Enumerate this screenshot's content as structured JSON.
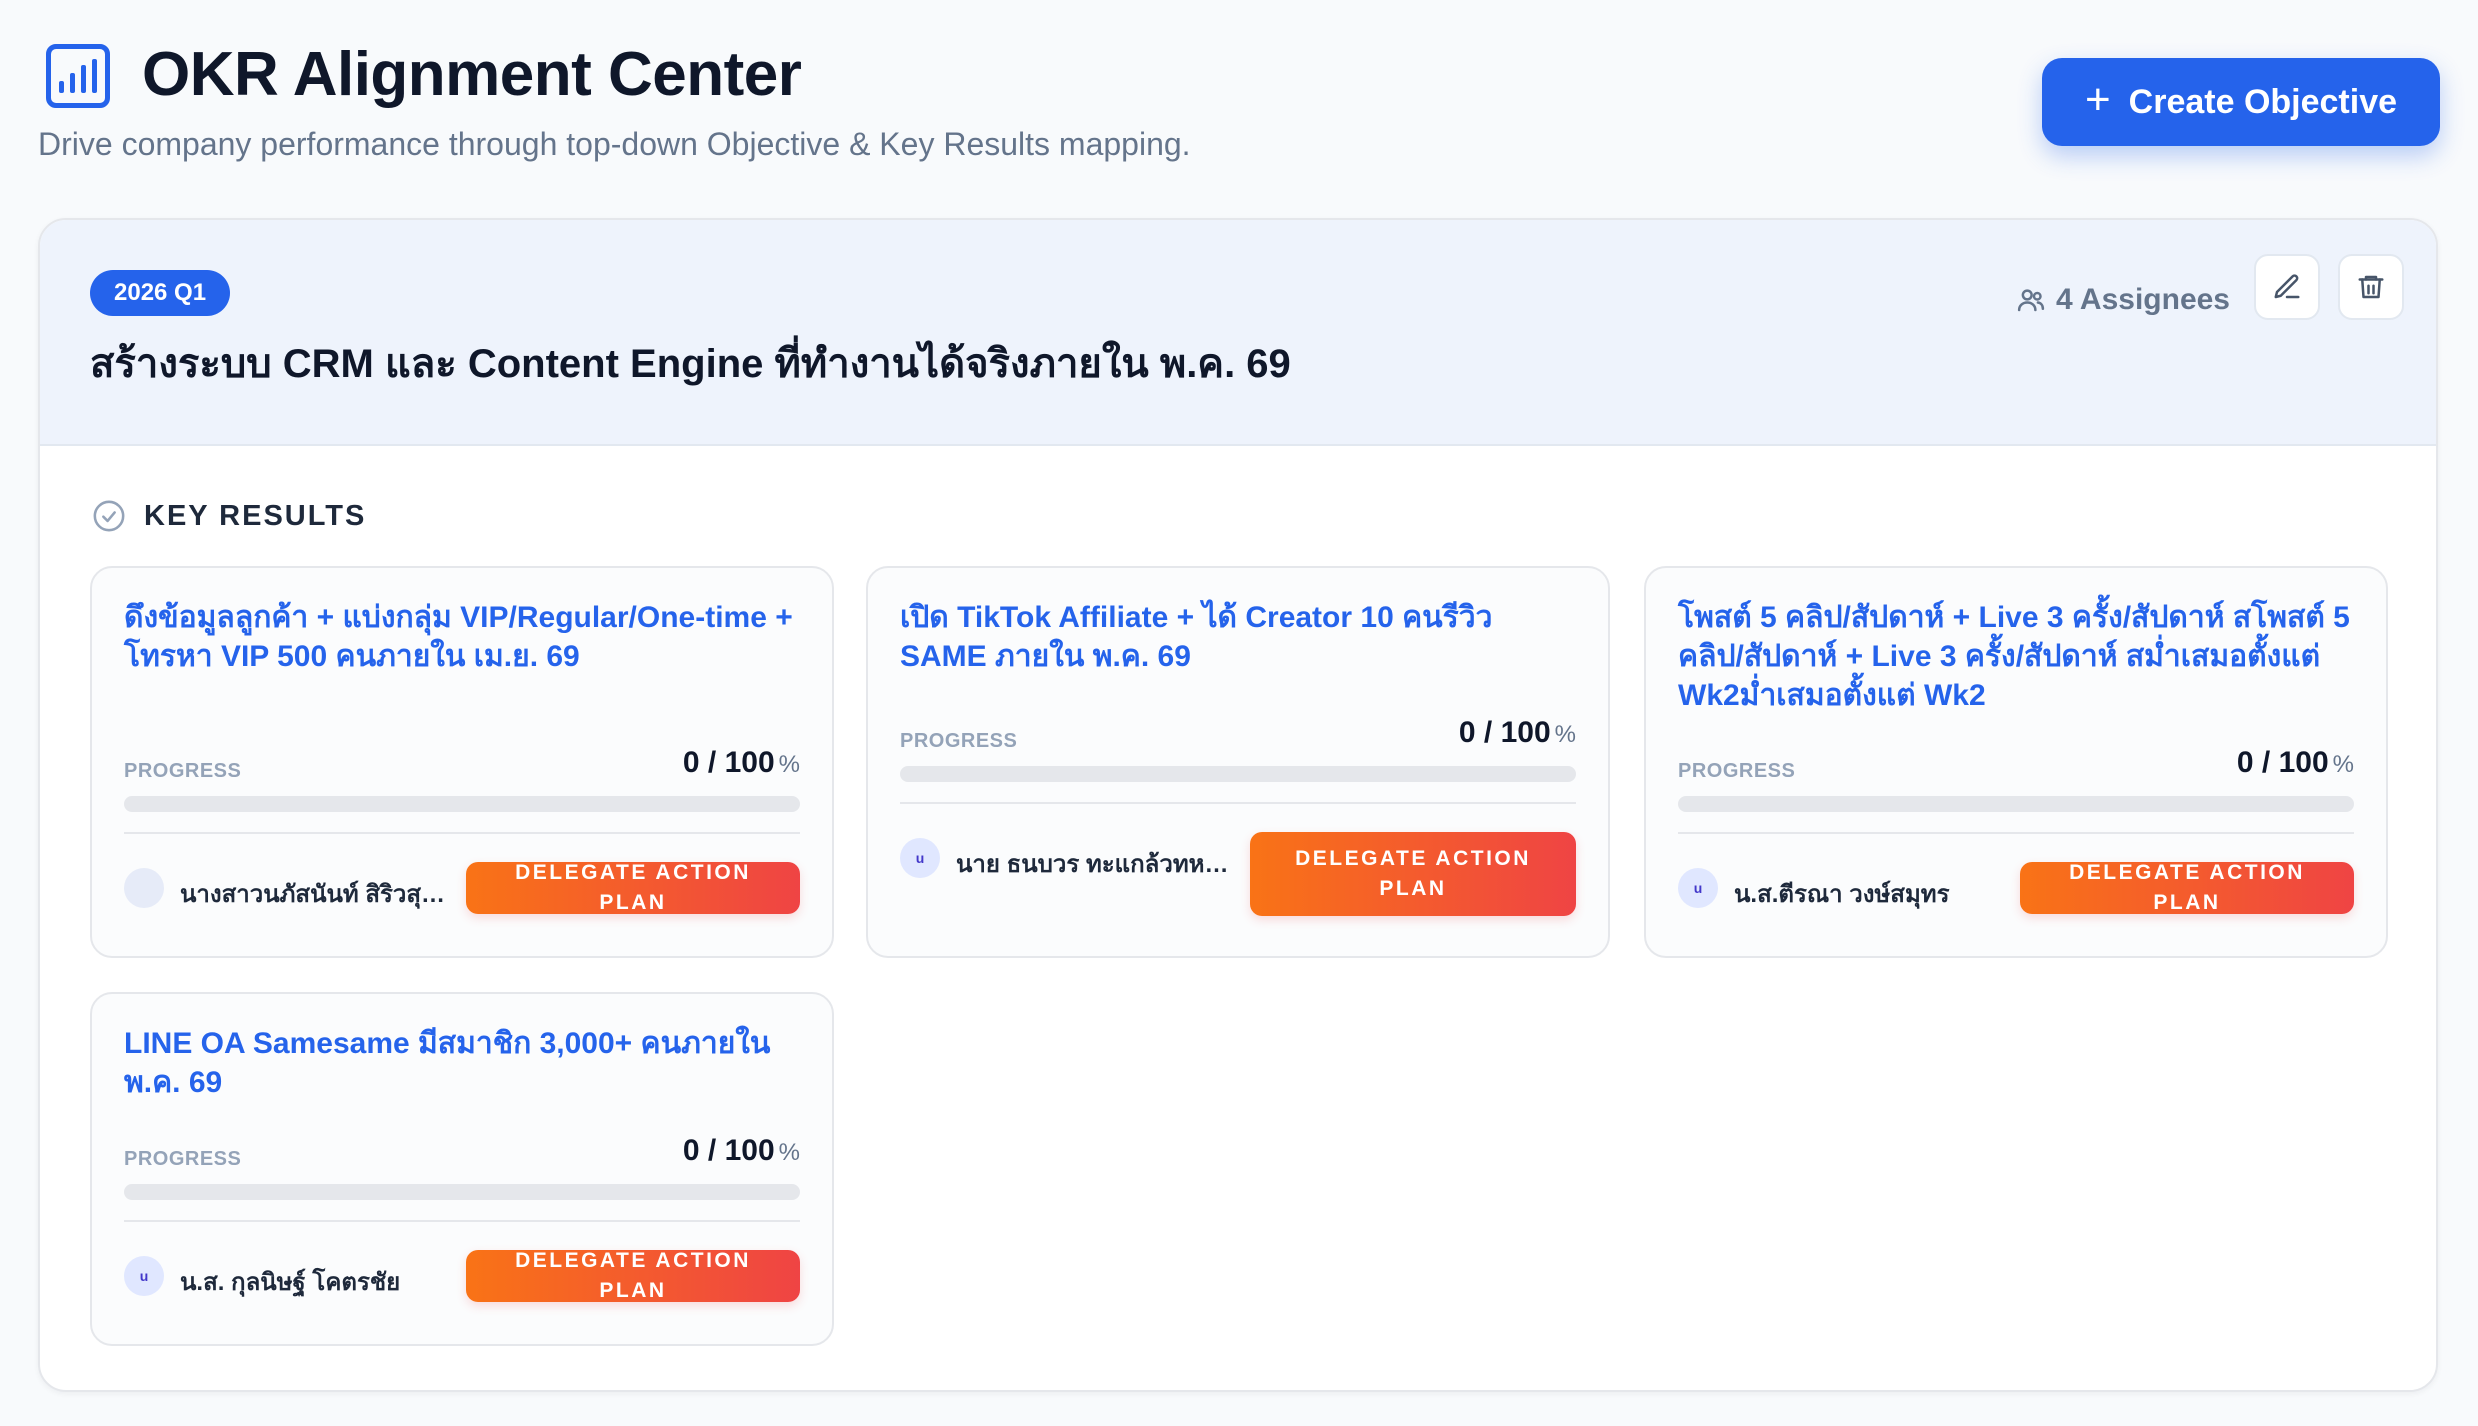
{
  "header": {
    "title": "OKR Alignment Center",
    "subtitle": "Drive company performance through top-down Objective & Key Results mapping.",
    "create_label": "Create Objective"
  },
  "objective": {
    "quarter": "2026 Q1",
    "title": "สร้างระบบ CRM และ Content Engine ที่ทำงานได้จริงภายใน พ.ค. 69",
    "assignees_label": "4 Assignees"
  },
  "key_results": {
    "heading": "KEY RESULTS",
    "progress_label": "PROGRESS",
    "delegate_label": "DELEGATE ACTION PLAN",
    "items": [
      {
        "title": "ดึงข้อมูลลูกค้า + แบ่งกลุ่ม VIP/Regular/One-time + โทรหา VIP 500 คนภายใน เม.ย. 69",
        "value": "0 / 100",
        "unit": "%",
        "progress": 0,
        "avatar": "",
        "owner": "นางสาวนภัสนันท์ สิริวสุรมย์"
      },
      {
        "title": "เปิด TikTok Affiliate + ได้ Creator 10 คนรีวิว SAME ภายใน พ.ค. 69",
        "value": "0 / 100",
        "unit": "%",
        "progress": 0,
        "avatar": "u",
        "owner": "นาย ธนบวร ทะแกล้วทหาร..."
      },
      {
        "title": "โพสต์ 5 คลิป/สัปดาห์ + Live 3 ครั้ง/สัปดาห์ สโพสต์ 5 คลิป/สัปดาห์ + Live 3 ครั้ง/สัปดาห์ สม่ำเสมอตั้งแต่ Wk2ม่ำเสมอตั้งแต่ Wk2",
        "value": "0 / 100",
        "unit": "%",
        "progress": 0,
        "avatar": "u",
        "owner": "น.ส.ตีรณา วงษ์สมุทร"
      },
      {
        "title": "LINE OA Samesame มีสมาชิก 3,000+ คนภายใน พ.ค. 69",
        "value": "0 / 100",
        "unit": "%",
        "progress": 0,
        "avatar": "u",
        "owner": "น.ส. กุลนิษฐ์ โคตรชัย"
      }
    ]
  },
  "colors": {
    "primary": "#2563eb",
    "delegate_gradient_start": "#f97316",
    "delegate_gradient_end": "#ef4444",
    "header_band": "#eef3fc"
  },
  "icons": {
    "logo": "bar-chart-icon",
    "create": "plus-icon",
    "assignees": "users-icon",
    "edit": "pencil-icon",
    "delete": "trash-icon",
    "key_results": "check-circle-icon"
  }
}
